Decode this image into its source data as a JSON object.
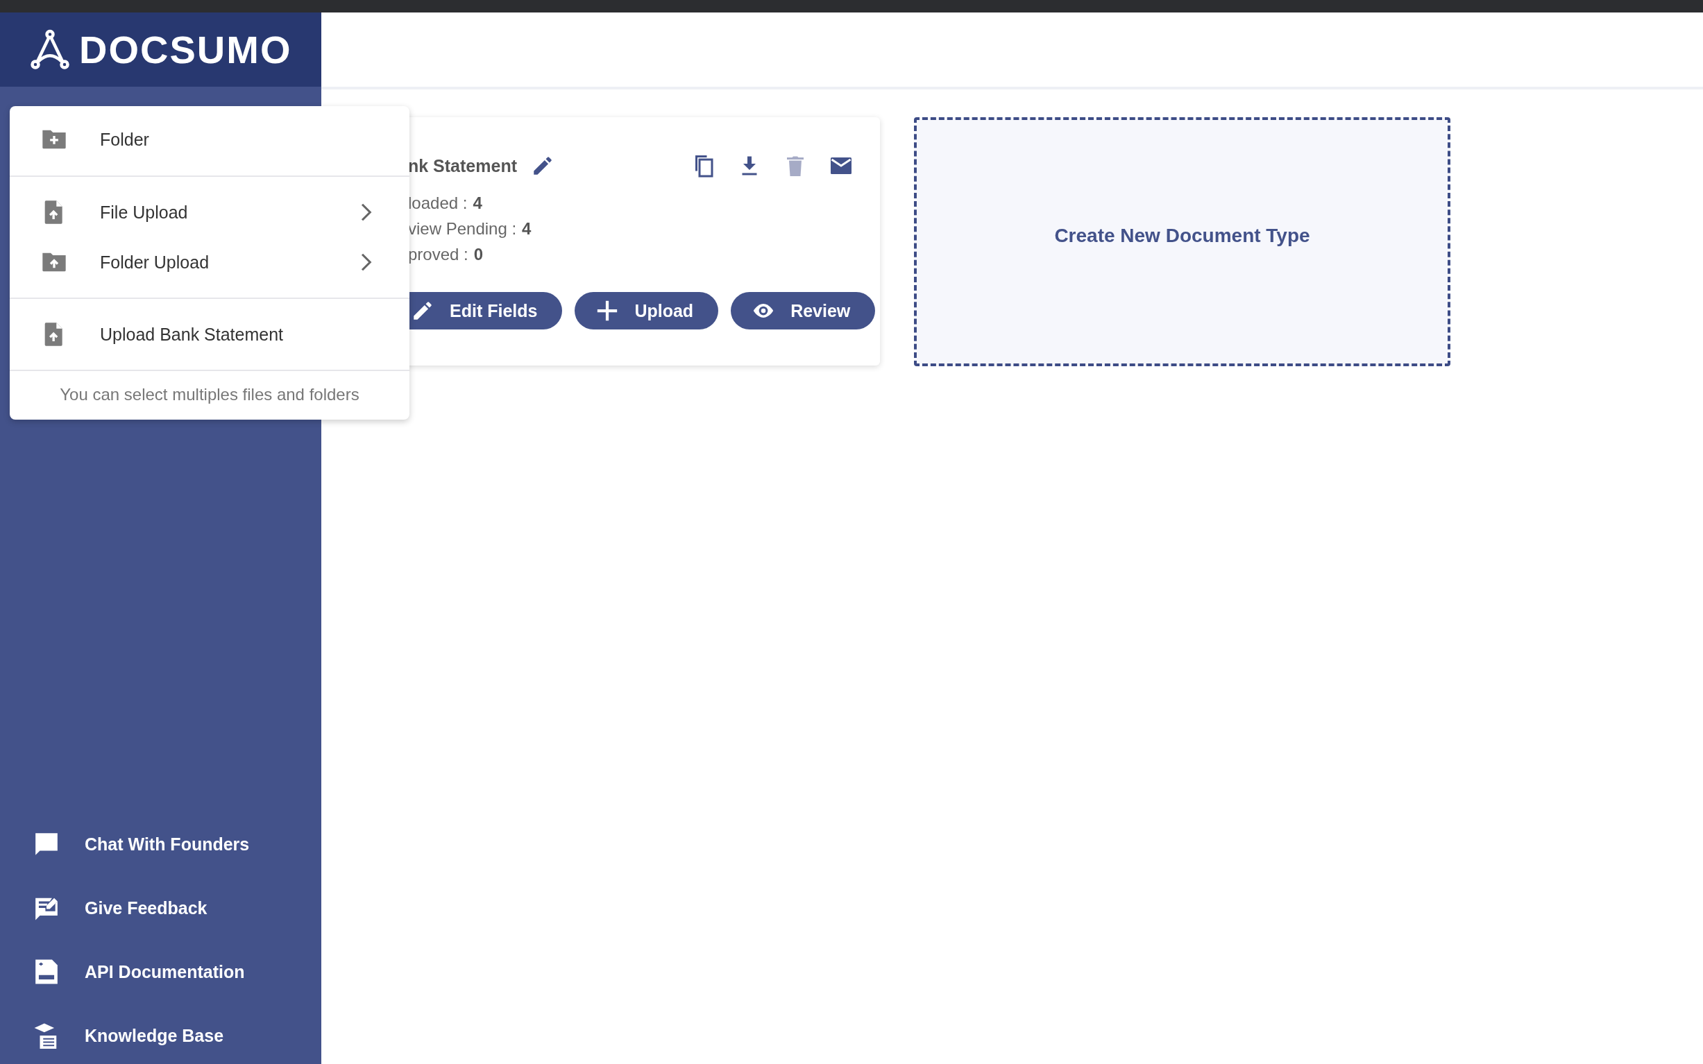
{
  "brand": {
    "name": "DOCSUMO"
  },
  "menu": {
    "sections": [
      [
        {
          "label": "Folder",
          "has_submenu": false
        }
      ],
      [
        {
          "label": "File Upload",
          "has_submenu": true
        },
        {
          "label": "Folder Upload",
          "has_submenu": true
        }
      ],
      [
        {
          "label": "Upload Bank Statement",
          "has_submenu": false
        }
      ]
    ],
    "hint": "You can select multiples files and folders"
  },
  "card": {
    "title": "nk Statement",
    "actions": [
      {
        "disabled": false
      },
      {
        "disabled": false
      },
      {
        "disabled": true
      },
      {
        "disabled": false
      }
    ],
    "stats": [
      {
        "label": "loaded :",
        "value": "4"
      },
      {
        "label": "view Pending :",
        "value": "4"
      },
      {
        "label": "proved :",
        "value": "0"
      }
    ],
    "buttons": [
      {
        "label": "Edit Fields"
      },
      {
        "label": "Upload"
      },
      {
        "label": "Review"
      }
    ]
  },
  "create_tile": {
    "label": "Create New Document Type"
  },
  "sidebar": {
    "links": [
      {
        "label": "Chat With Founders"
      },
      {
        "label": "Give Feedback"
      },
      {
        "label": "API Documentation"
      },
      {
        "label": "Knowledge Base"
      }
    ]
  }
}
